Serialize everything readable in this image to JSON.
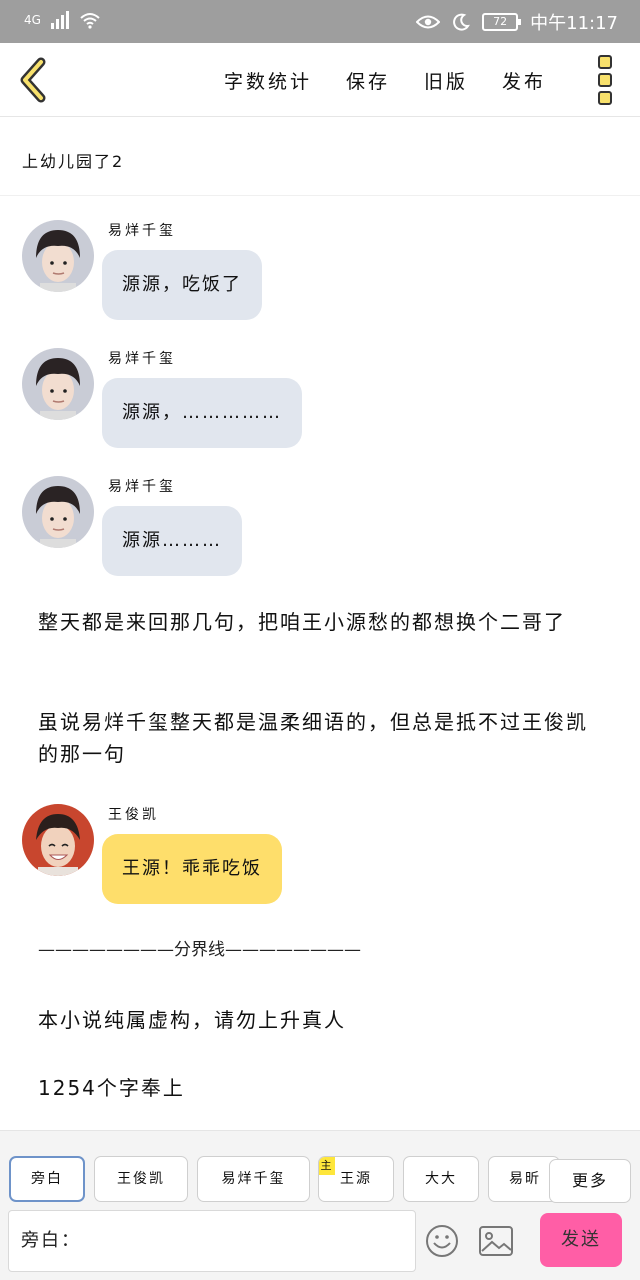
{
  "status_bar": {
    "network": "4G",
    "battery": "72",
    "time": "中午11:17"
  },
  "toolbar": {
    "actions": [
      "字数统计",
      "保存",
      "旧版",
      "发布"
    ]
  },
  "chapter_title": "上幼儿园了2",
  "messages": [
    {
      "speaker": "易烊千玺",
      "text": "源源，吃饭了"
    },
    {
      "speaker": "易烊千玺",
      "text": "源源，……………"
    },
    {
      "speaker": "易烊千玺",
      "text": "源源………"
    }
  ],
  "paragraphs": [
    "整天都是来回那几句，把咱王小源愁的都想换个二哥了",
    "虽说易烊千玺整天都是温柔细语的，但总是抵不过王俊凯的那一句"
  ],
  "message_wjk": {
    "speaker": "王俊凯",
    "text": "王源！乖乖吃饭"
  },
  "divider_text": "————————分界线————————",
  "disclaimer": "本小说纯属虚构，请勿上升真人",
  "word_count_note": "1254个字奉上",
  "role_bar": {
    "roles": [
      "旁白",
      "王俊凯",
      "易烊千玺",
      "王源",
      "大大",
      "易昕"
    ],
    "main_badge": "主",
    "more_label": "更多",
    "input_prefix": "旁白：",
    "send_label": "发送"
  },
  "colors": {
    "bubble_gray": "#e1e6ee",
    "bubble_yellow": "#fede6b",
    "send_pink": "#ff5ea6",
    "status_bar": "#9e9e9e"
  },
  "icons": [
    "back-chevron-icon",
    "more-menu-icon",
    "eye-icon",
    "moon-icon",
    "emoji-icon",
    "image-icon"
  ]
}
